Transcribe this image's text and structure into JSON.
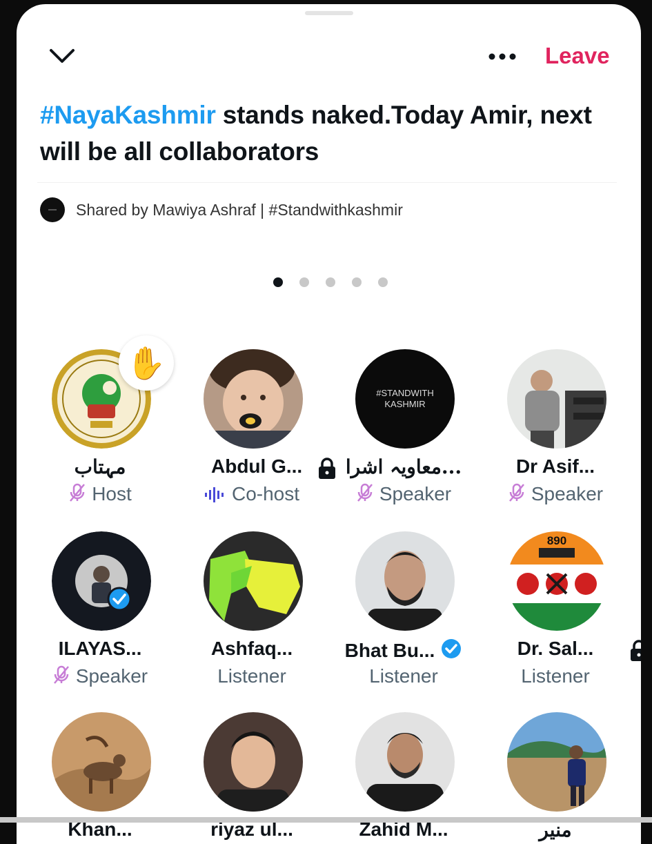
{
  "space": {
    "title_hashtag": "#NayaKashmir",
    "title_rest": " stands naked.Today Amir, next will be all collaborators",
    "shared_by": "Shared by Mawiya Ashraf | #Standwithkashmir",
    "leave_label": "Leave",
    "page_count": 5,
    "active_page": 1
  },
  "participants": [
    {
      "name": "مہتاب",
      "role": "Host",
      "role_icon": "mic-off-icon"
    },
    {
      "name": "Abdul G...",
      "role": "Co-host",
      "role_icon": "audio-wave-icon",
      "badge": "lock-icon"
    },
    {
      "name": "معاویہ اشرا...",
      "role": "Speaker",
      "role_icon": "mic-off-icon",
      "avatar_text": "#STANDWITH KASHMIR"
    },
    {
      "name": "Dr Asif...",
      "role": "Speaker",
      "role_icon": "mic-off-icon"
    },
    {
      "name": "ILAYAS...",
      "role": "Speaker",
      "role_icon": "mic-off-icon"
    },
    {
      "name": "Ashfaq...",
      "role": "Listener"
    },
    {
      "name": "Bhat Bu...",
      "role": "Listener",
      "badge": "verified-icon"
    },
    {
      "name": "Dr. Sal...",
      "role": "Listener",
      "badge": "lock-icon",
      "avatar_text": "890"
    },
    {
      "name": "Khan...",
      "role": ""
    },
    {
      "name": "riyaz ul...",
      "role": ""
    },
    {
      "name": "Zahid M...",
      "role": ""
    },
    {
      "name": "منیر",
      "role": ""
    }
  ],
  "colors": {
    "accent_blue": "#1d9bf0",
    "leave_red": "#e0245e",
    "mic_purple": "#c77dd6",
    "cohost_blue": "#4a4ad8"
  }
}
